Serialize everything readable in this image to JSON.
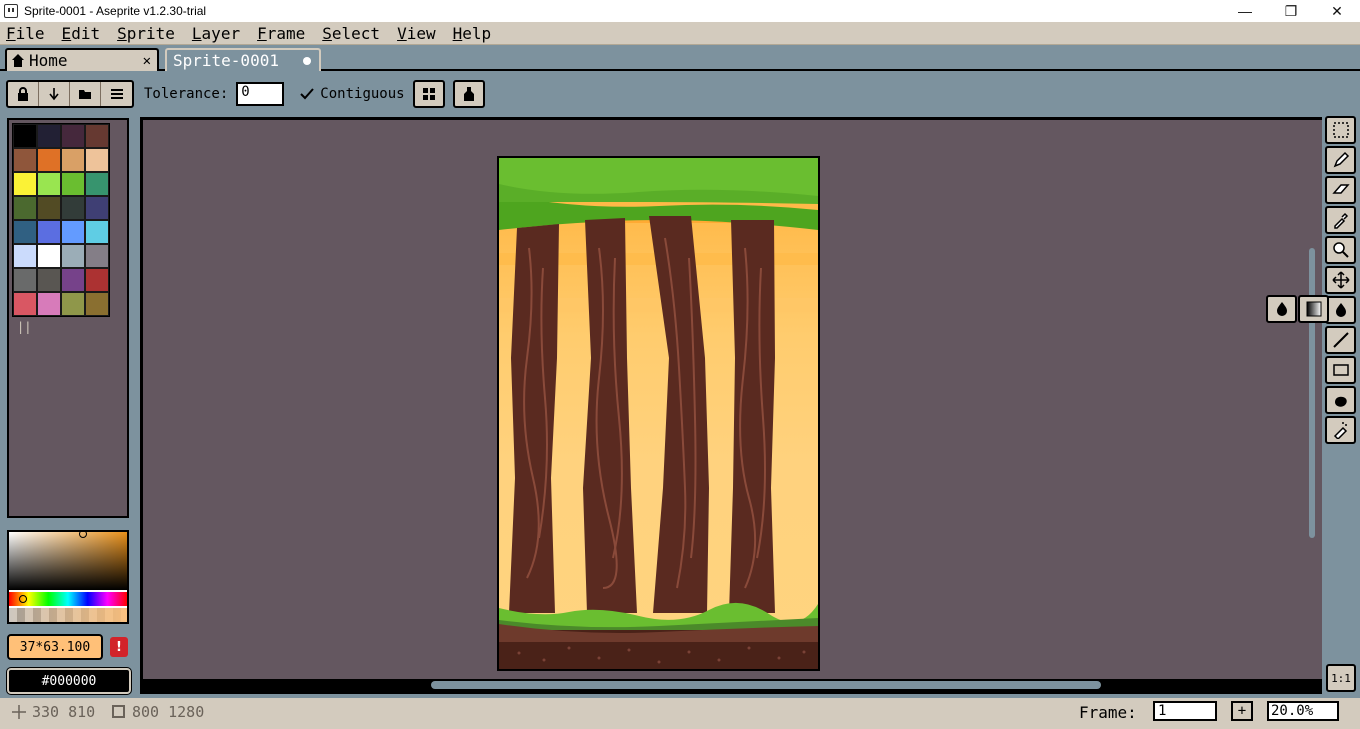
{
  "window": {
    "title": "Sprite-0001 - Aseprite v1.2.30-trial",
    "minimize": "—",
    "maximize": "❐",
    "close": "✕"
  },
  "menu": {
    "items": [
      {
        "first": "F",
        "rest": "ile"
      },
      {
        "first": "E",
        "rest": "dit"
      },
      {
        "first": "S",
        "rest": "prite"
      },
      {
        "first": "L",
        "rest": "ayer"
      },
      {
        "first": "F",
        "rest": "rame"
      },
      {
        "first": "S",
        "rest": "elect"
      },
      {
        "first": "V",
        "rest": "iew"
      },
      {
        "first": "H",
        "rest": "elp"
      }
    ]
  },
  "tabs": {
    "home_label": "Home",
    "home_close": "✕",
    "sprite_label": "Sprite-0001"
  },
  "context": {
    "tolerance_label": "Tolerance:",
    "tolerance_value": "0",
    "contiguous_label": "Contiguous",
    "contiguous_checked": true
  },
  "palette": {
    "colors": [
      "#000000",
      "#222034",
      "#45283c",
      "#663931",
      "#8f563b",
      "#df7126",
      "#d9a066",
      "#eec39a",
      "#fbf236",
      "#99e550",
      "#6abe30",
      "#37946e",
      "#4b692f",
      "#524b24",
      "#323c39",
      "#3f3f74",
      "#306082",
      "#5b6ee1",
      "#639bff",
      "#5fcde4",
      "#cbdbfc",
      "#ffffff",
      "#9badb7",
      "#847e87",
      "#696a6a",
      "#595652",
      "#76428a",
      "#ac3232",
      "#d95763",
      "#d77bba",
      "#8f974a",
      "#8a6f30"
    ]
  },
  "color": {
    "foreground_label": "37*63.100",
    "background_label": "#000000",
    "accent_fg": "#ffc078"
  },
  "status": {
    "cursor_pos": "330 810",
    "sprite_size": "800 1280",
    "frame_label": "Frame:",
    "frame_value": "1",
    "zoom_value": "20.0%"
  },
  "toolbar": {
    "tools": [
      "marquee-icon",
      "pencil-icon",
      "eraser-icon",
      "eyedropper-icon",
      "zoom-icon",
      "move-icon",
      "paint-bucket-icon",
      "line-icon",
      "rectangle-icon",
      "blob-icon",
      "spray-icon"
    ],
    "zoom_label": "1:1"
  }
}
